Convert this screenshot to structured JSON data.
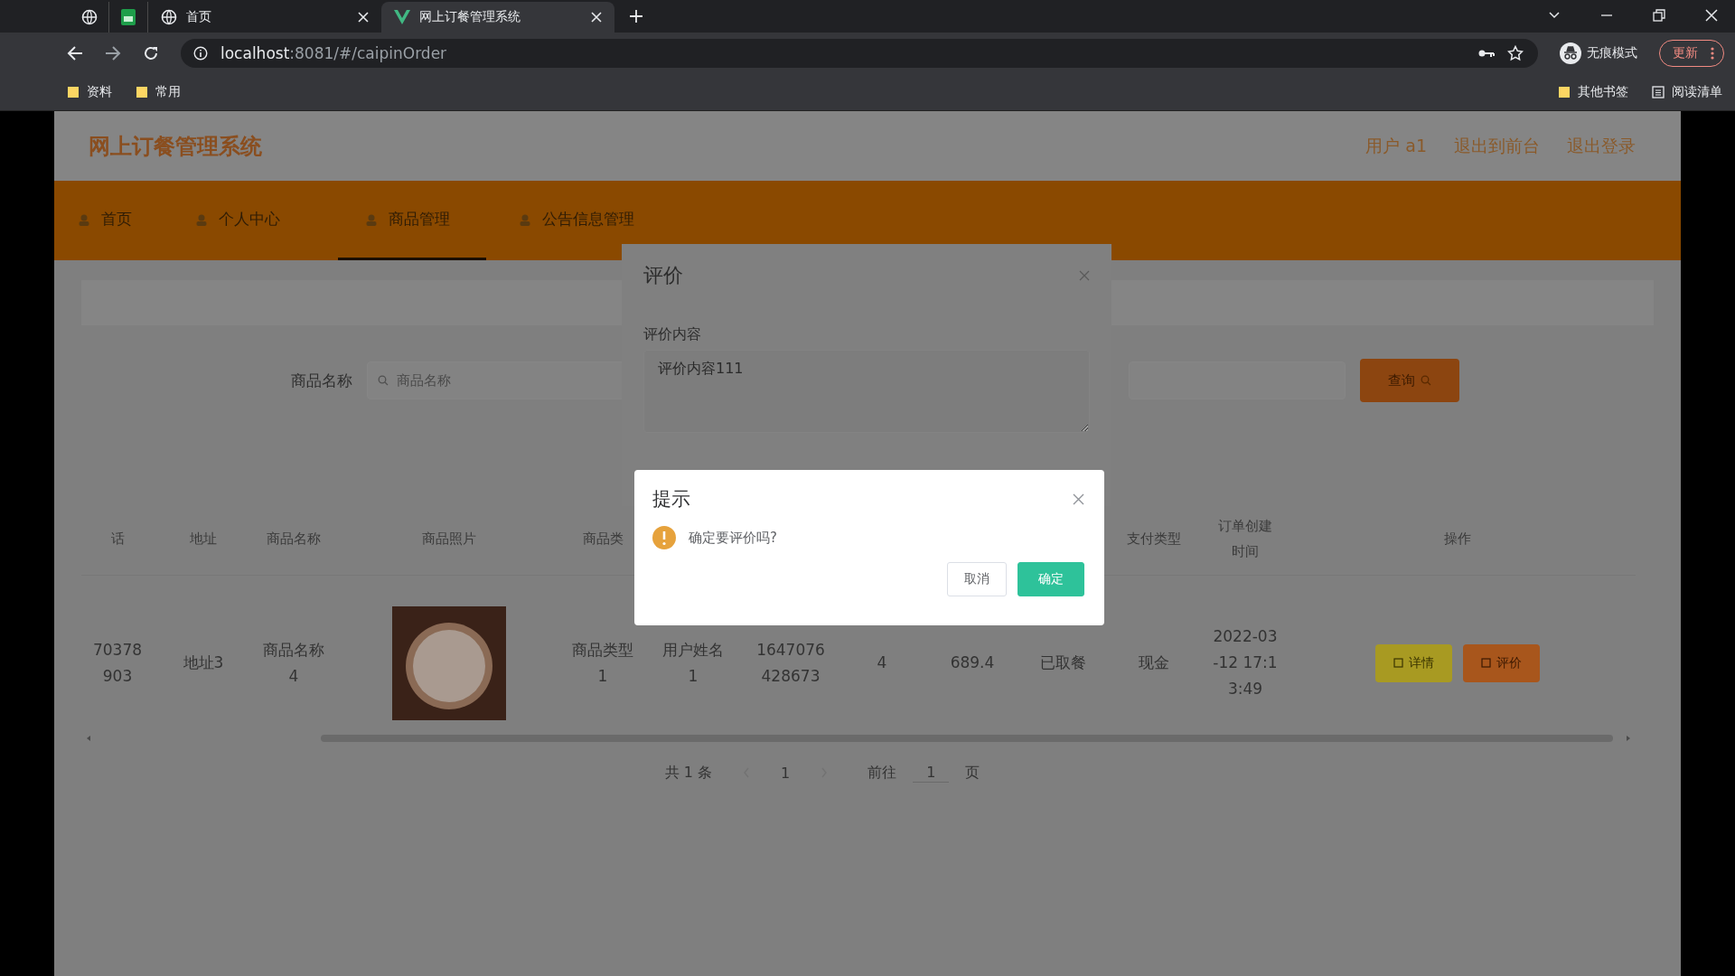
{
  "browser": {
    "tabs": [
      {
        "kind": "pinned",
        "selected": false
      },
      {
        "kind": "pinned",
        "selected": false
      },
      {
        "kind": "page",
        "title": "首页",
        "selected": false
      },
      {
        "kind": "page",
        "title": "网上订餐管理系统",
        "selected": true
      }
    ],
    "address": {
      "host": "localhost",
      "rest": ":8081/#/caipinOrder"
    },
    "profile_label": "无痕模式",
    "update_button": "更新",
    "bookmarks": [
      {
        "label": "资料"
      },
      {
        "label": "常用"
      }
    ],
    "bookmarks_right": [
      {
        "kind": "folder",
        "label": "其他书签"
      },
      {
        "kind": "list",
        "label": "阅读清单"
      }
    ]
  },
  "app": {
    "title": "网上订餐管理系统",
    "header_links": [
      "用户 a1",
      "退出到前台",
      "退出登录"
    ],
    "nav": [
      {
        "label": "首页",
        "selected": false
      },
      {
        "label": "个人中心",
        "selected": false
      },
      {
        "label": "商品管理",
        "selected": true
      },
      {
        "label": "公告信息管理",
        "selected": false
      }
    ],
    "search": {
      "label": "商品名称",
      "placeholder": "商品名称",
      "button": "查询"
    },
    "table": {
      "columns": [
        {
          "lines": [
            "话"
          ]
        },
        {
          "lines": [
            "地址"
          ]
        },
        {
          "lines": [
            "商品名称"
          ]
        },
        {
          "lines": [
            "商品照片"
          ]
        },
        {
          "lines": [
            "商品类"
          ]
        },
        {},
        {},
        {},
        {},
        {},
        {
          "lines": [
            "支付类型"
          ]
        },
        {
          "lines": [
            "订单创建",
            "时间"
          ]
        },
        {
          "lines": [
            "操作"
          ]
        }
      ],
      "rows": [
        {
          "cells": [
            {
              "kind": "text",
              "lines": [
                "70378",
                "903"
              ]
            },
            {
              "kind": "text",
              "lines": [
                "地址3"
              ]
            },
            {
              "kind": "text",
              "lines": [
                "商品名称",
                "4"
              ]
            },
            {
              "kind": "photo"
            },
            {
              "kind": "text",
              "lines": [
                "商品类型",
                "1"
              ]
            },
            {
              "kind": "text",
              "lines": [
                "用户姓名",
                "1"
              ]
            },
            {
              "kind": "text",
              "lines": [
                "1647076",
                "428673"
              ]
            },
            {
              "kind": "text",
              "lines": [
                "4"
              ]
            },
            {
              "kind": "text",
              "lines": [
                "689.4"
              ]
            },
            {
              "kind": "text",
              "lines": [
                "已取餐"
              ]
            },
            {
              "kind": "text",
              "lines": [
                "现金"
              ]
            },
            {
              "kind": "text",
              "lines": [
                "2022-03",
                "-12 17:1",
                "3:49"
              ]
            },
            {
              "kind": "actions",
              "buttons": [
                {
                  "kind": "info",
                  "label": "详情"
                },
                {
                  "kind": "warn",
                  "label": "评价"
                }
              ]
            }
          ]
        }
      ]
    },
    "pagination": {
      "total": "共 1 条",
      "page": "1",
      "goto": "前往",
      "goto_value": "1",
      "unit": "页"
    }
  },
  "review_dialog": {
    "title": "评价",
    "field_label": "评价内容",
    "field_value": "评价内容111"
  },
  "confirm_dialog": {
    "title": "提示",
    "message": "确定要评价吗?",
    "buttons": [
      {
        "kind": "cancel",
        "label": "取消"
      },
      {
        "kind": "primary",
        "label": "确定"
      }
    ]
  }
}
